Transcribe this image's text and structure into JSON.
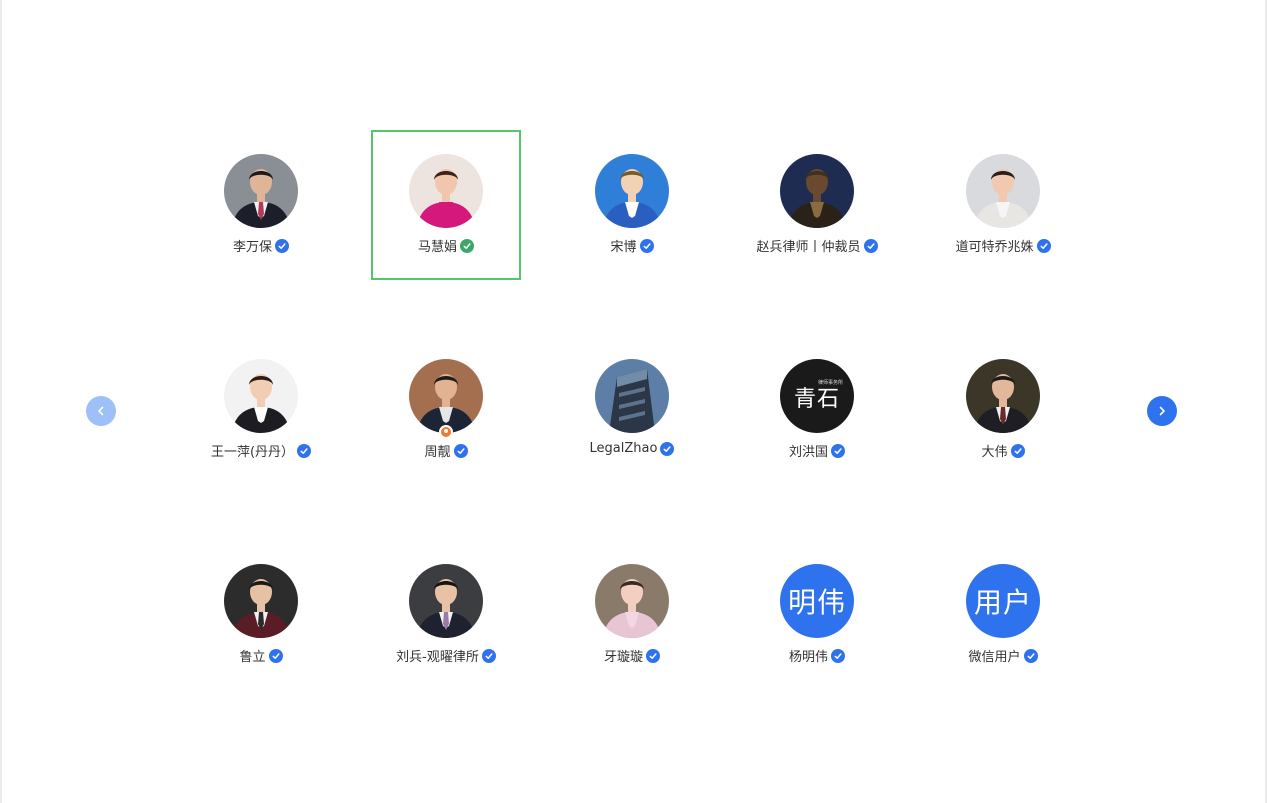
{
  "accent_color": "#2f72ee",
  "selected_border_color": "#57c46a",
  "carousel": {
    "prev_icon": "chevron-left-icon",
    "next_icon": "chevron-right-icon"
  },
  "profiles": [
    {
      "name": "李万保",
      "avatar": "photo",
      "verified": "blue"
    },
    {
      "name": "马慧娟",
      "avatar": "photo",
      "verified": "green",
      "selected": true
    },
    {
      "name": "宋博",
      "avatar": "photo",
      "verified": "blue"
    },
    {
      "name": "赵兵律师丨仲裁员",
      "avatar": "photo",
      "verified": "blue"
    },
    {
      "name": "道可特乔兆姝",
      "avatar": "photo",
      "verified": "blue"
    },
    {
      "name": "王一萍(丹丹）",
      "avatar": "photo",
      "verified": "blue"
    },
    {
      "name": "周靓",
      "avatar": "photo",
      "verified": "blue",
      "badge": "orange"
    },
    {
      "name": "LegalZhao",
      "avatar": "photo",
      "verified": "blue"
    },
    {
      "name": "刘洪国",
      "avatar": "photo",
      "verified": "blue",
      "avatar_text": "青石",
      "avatar_subtext": "律师事务所"
    },
    {
      "name": "大伟",
      "avatar": "photo",
      "verified": "blue"
    },
    {
      "name": "鲁立",
      "avatar": "photo",
      "verified": "blue"
    },
    {
      "name": "刘兵-观曜律所",
      "avatar": "photo",
      "verified": "blue"
    },
    {
      "name": "牙璇璇",
      "avatar": "photo",
      "verified": "blue"
    },
    {
      "name": "杨明伟",
      "avatar": "text",
      "avatar_text": "明伟",
      "verified": "blue"
    },
    {
      "name": "微信用户",
      "avatar": "text",
      "avatar_text": "用户",
      "verified": "blue"
    }
  ]
}
